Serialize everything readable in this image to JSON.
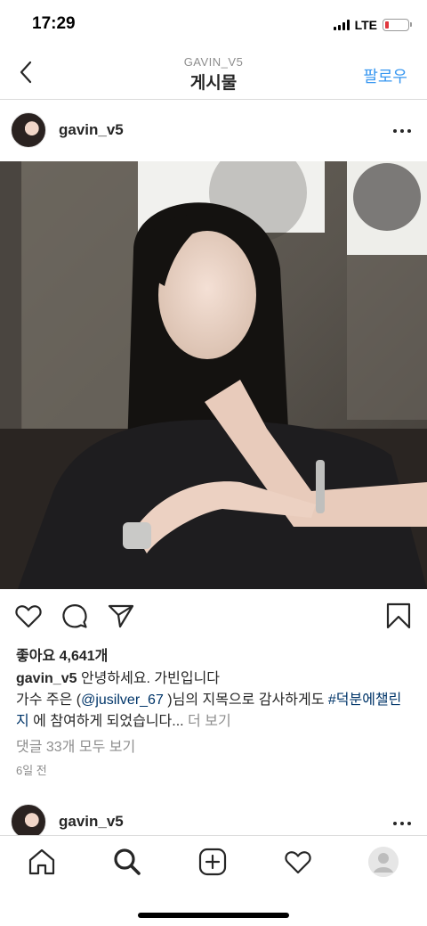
{
  "status_bar": {
    "time": "17:29",
    "network": "LTE",
    "battery_level": 0.15
  },
  "nav": {
    "subtitle": "GAVIN_V5",
    "title": "게시물",
    "follow": "팔로우"
  },
  "post": {
    "username": "gavin_v5",
    "likes": "좋아요 4,641개",
    "caption": {
      "username": "gavin_v5",
      "line1": "안녕하세요. 가빈입니다",
      "part_a": "가수 주은 (",
      "mention": "@jusilver_67",
      "part_b": " )님의 지목으로 감사하게도 ",
      "hashtag": "#덕분에챌린지",
      "part_c": " 에 참여하게 되었습니다...",
      "more": " 더 보기"
    },
    "comments": "댓글 33개 모두 보기",
    "time": "6일 전"
  },
  "next_post": {
    "username": "gavin_v5"
  },
  "icons": {
    "back": "chevron-left-icon",
    "more": "more-horizontal-icon",
    "like": "heart-icon",
    "comment": "comment-icon",
    "share": "paper-plane-icon",
    "save": "bookmark-icon",
    "home": "home-icon",
    "search": "search-icon",
    "add": "add-post-icon",
    "activity": "heart-icon",
    "profile": "profile-avatar-icon"
  },
  "colors": {
    "accent": "#3897f0",
    "link": "#003569",
    "muted": "#8e8e8e",
    "text": "#262626"
  }
}
